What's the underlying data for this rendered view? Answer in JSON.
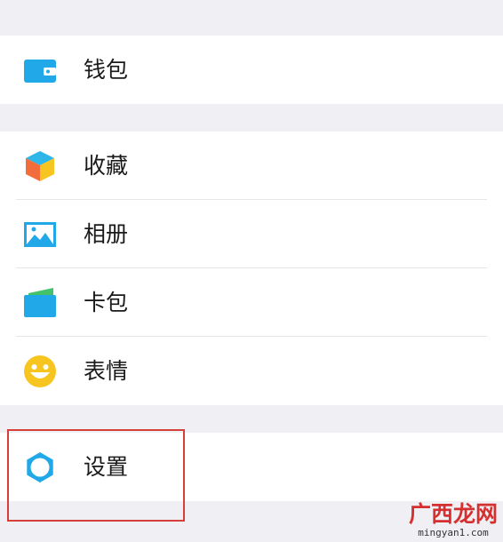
{
  "wallet": {
    "label": "钱包",
    "icon": "wallet-icon"
  },
  "items": [
    {
      "label": "收藏",
      "icon": "favorites-cube-icon"
    },
    {
      "label": "相册",
      "icon": "album-image-icon"
    },
    {
      "label": "卡包",
      "icon": "card-wallet-icon"
    },
    {
      "label": "表情",
      "icon": "smiley-face-icon"
    }
  ],
  "settings": {
    "label": "设置",
    "icon": "gear-icon"
  },
  "watermark": {
    "brand": "广西龙网",
    "domain": "mingyan1.com"
  },
  "colors": {
    "background": "#efeff4",
    "row_bg": "#ffffff",
    "icon_blue": "#20a8e8",
    "icon_green": "#44c26a",
    "smiley_yellow": "#f7c51f",
    "highlight_red": "#d6403a"
  }
}
